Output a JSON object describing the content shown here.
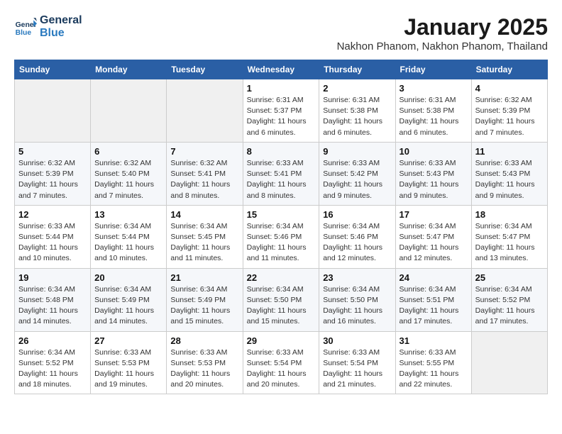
{
  "header": {
    "logo_line1": "General",
    "logo_line2": "Blue",
    "month": "January 2025",
    "location": "Nakhon Phanom, Nakhon Phanom, Thailand"
  },
  "weekdays": [
    "Sunday",
    "Monday",
    "Tuesday",
    "Wednesday",
    "Thursday",
    "Friday",
    "Saturday"
  ],
  "weeks": [
    [
      {
        "day": null
      },
      {
        "day": null
      },
      {
        "day": null
      },
      {
        "day": "1",
        "sunrise": "6:31 AM",
        "sunset": "5:37 PM",
        "daylight": "11 hours and 6 minutes."
      },
      {
        "day": "2",
        "sunrise": "6:31 AM",
        "sunset": "5:38 PM",
        "daylight": "11 hours and 6 minutes."
      },
      {
        "day": "3",
        "sunrise": "6:31 AM",
        "sunset": "5:38 PM",
        "daylight": "11 hours and 6 minutes."
      },
      {
        "day": "4",
        "sunrise": "6:32 AM",
        "sunset": "5:39 PM",
        "daylight": "11 hours and 7 minutes."
      }
    ],
    [
      {
        "day": "5",
        "sunrise": "6:32 AM",
        "sunset": "5:39 PM",
        "daylight": "11 hours and 7 minutes."
      },
      {
        "day": "6",
        "sunrise": "6:32 AM",
        "sunset": "5:40 PM",
        "daylight": "11 hours and 7 minutes."
      },
      {
        "day": "7",
        "sunrise": "6:32 AM",
        "sunset": "5:41 PM",
        "daylight": "11 hours and 8 minutes."
      },
      {
        "day": "8",
        "sunrise": "6:33 AM",
        "sunset": "5:41 PM",
        "daylight": "11 hours and 8 minutes."
      },
      {
        "day": "9",
        "sunrise": "6:33 AM",
        "sunset": "5:42 PM",
        "daylight": "11 hours and 9 minutes."
      },
      {
        "day": "10",
        "sunrise": "6:33 AM",
        "sunset": "5:43 PM",
        "daylight": "11 hours and 9 minutes."
      },
      {
        "day": "11",
        "sunrise": "6:33 AM",
        "sunset": "5:43 PM",
        "daylight": "11 hours and 9 minutes."
      }
    ],
    [
      {
        "day": "12",
        "sunrise": "6:33 AM",
        "sunset": "5:44 PM",
        "daylight": "11 hours and 10 minutes."
      },
      {
        "day": "13",
        "sunrise": "6:34 AM",
        "sunset": "5:44 PM",
        "daylight": "11 hours and 10 minutes."
      },
      {
        "day": "14",
        "sunrise": "6:34 AM",
        "sunset": "5:45 PM",
        "daylight": "11 hours and 11 minutes."
      },
      {
        "day": "15",
        "sunrise": "6:34 AM",
        "sunset": "5:46 PM",
        "daylight": "11 hours and 11 minutes."
      },
      {
        "day": "16",
        "sunrise": "6:34 AM",
        "sunset": "5:46 PM",
        "daylight": "11 hours and 12 minutes."
      },
      {
        "day": "17",
        "sunrise": "6:34 AM",
        "sunset": "5:47 PM",
        "daylight": "11 hours and 12 minutes."
      },
      {
        "day": "18",
        "sunrise": "6:34 AM",
        "sunset": "5:47 PM",
        "daylight": "11 hours and 13 minutes."
      }
    ],
    [
      {
        "day": "19",
        "sunrise": "6:34 AM",
        "sunset": "5:48 PM",
        "daylight": "11 hours and 14 minutes."
      },
      {
        "day": "20",
        "sunrise": "6:34 AM",
        "sunset": "5:49 PM",
        "daylight": "11 hours and 14 minutes."
      },
      {
        "day": "21",
        "sunrise": "6:34 AM",
        "sunset": "5:49 PM",
        "daylight": "11 hours and 15 minutes."
      },
      {
        "day": "22",
        "sunrise": "6:34 AM",
        "sunset": "5:50 PM",
        "daylight": "11 hours and 15 minutes."
      },
      {
        "day": "23",
        "sunrise": "6:34 AM",
        "sunset": "5:50 PM",
        "daylight": "11 hours and 16 minutes."
      },
      {
        "day": "24",
        "sunrise": "6:34 AM",
        "sunset": "5:51 PM",
        "daylight": "11 hours and 17 minutes."
      },
      {
        "day": "25",
        "sunrise": "6:34 AM",
        "sunset": "5:52 PM",
        "daylight": "11 hours and 17 minutes."
      }
    ],
    [
      {
        "day": "26",
        "sunrise": "6:34 AM",
        "sunset": "5:52 PM",
        "daylight": "11 hours and 18 minutes."
      },
      {
        "day": "27",
        "sunrise": "6:33 AM",
        "sunset": "5:53 PM",
        "daylight": "11 hours and 19 minutes."
      },
      {
        "day": "28",
        "sunrise": "6:33 AM",
        "sunset": "5:53 PM",
        "daylight": "11 hours and 20 minutes."
      },
      {
        "day": "29",
        "sunrise": "6:33 AM",
        "sunset": "5:54 PM",
        "daylight": "11 hours and 20 minutes."
      },
      {
        "day": "30",
        "sunrise": "6:33 AM",
        "sunset": "5:54 PM",
        "daylight": "11 hours and 21 minutes."
      },
      {
        "day": "31",
        "sunrise": "6:33 AM",
        "sunset": "5:55 PM",
        "daylight": "11 hours and 22 minutes."
      },
      {
        "day": null
      }
    ]
  ],
  "labels": {
    "sunrise": "Sunrise:",
    "sunset": "Sunset:",
    "daylight": "Daylight:"
  }
}
